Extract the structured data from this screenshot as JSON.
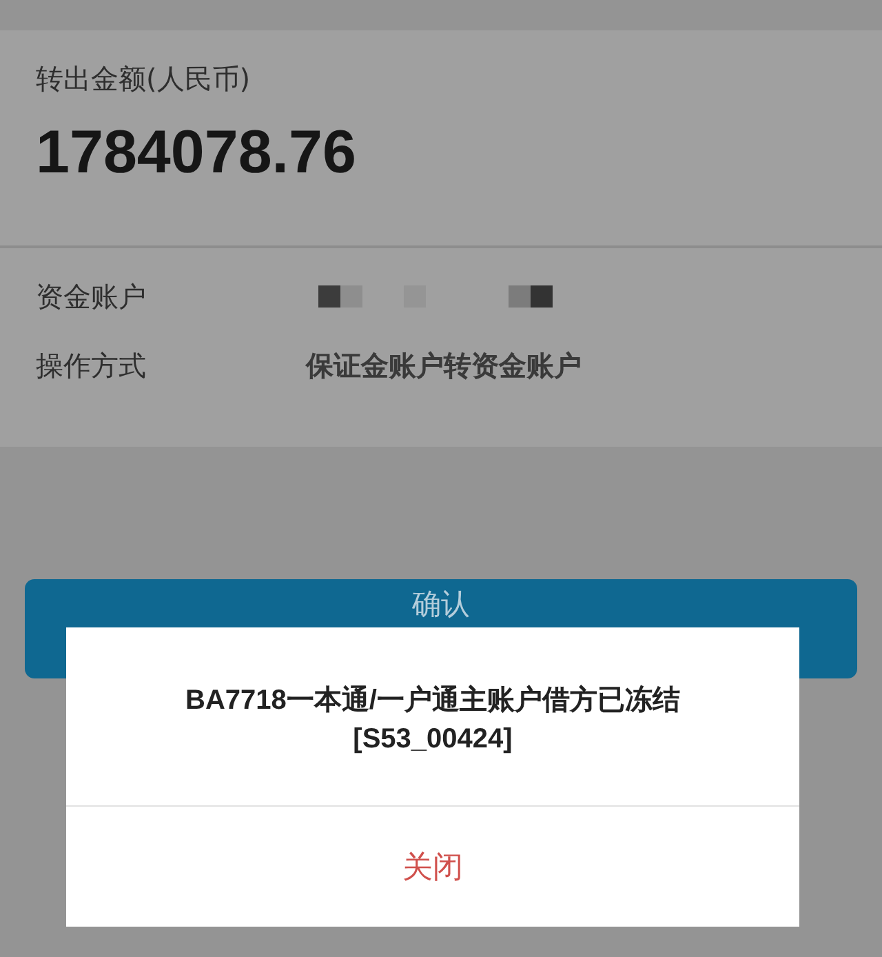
{
  "transfer": {
    "amount_label": "转出金额(人民币)",
    "amount": "1784078.76"
  },
  "details": [
    {
      "label": "资金账户",
      "kind": "masked"
    },
    {
      "label": "操作方式",
      "kind": "text",
      "value": "保证金账户转资金账户"
    }
  ],
  "confirm_button": "确认",
  "dialog": {
    "message_lines": [
      "BA7718一本通/一户通主账户借方已冻结",
      "[S53_00424]"
    ],
    "close_button": "关闭"
  }
}
